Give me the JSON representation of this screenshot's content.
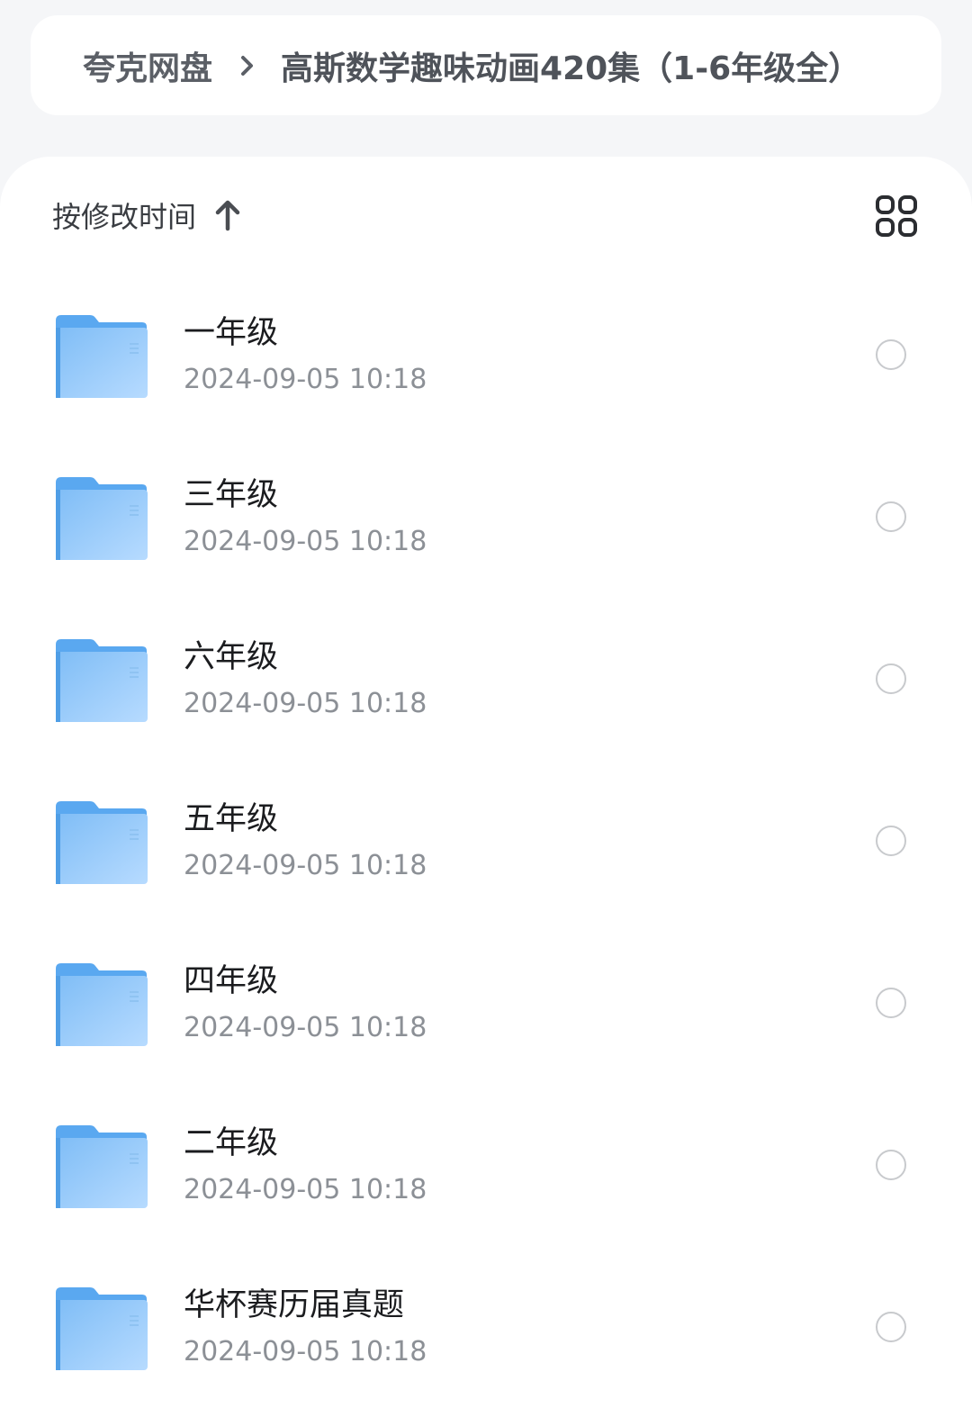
{
  "breadcrumb": {
    "root": "夸克网盘",
    "current": "高斯数学趣味动画420集（1-6年级全）"
  },
  "sort": {
    "label": "按修改时间",
    "direction_icon": "arrow-up-icon"
  },
  "view_toggle_icon": "grid-view-icon",
  "colors": {
    "folder_light": "#b7dbff",
    "folder_dark": "#5aa8f0",
    "background": "#f5f6f8"
  },
  "files": [
    {
      "name": "一年级",
      "time": "2024-09-05 10:18"
    },
    {
      "name": "三年级",
      "time": "2024-09-05 10:18"
    },
    {
      "name": "六年级",
      "time": "2024-09-05 10:18"
    },
    {
      "name": "五年级",
      "time": "2024-09-05 10:18"
    },
    {
      "name": "四年级",
      "time": "2024-09-05 10:18"
    },
    {
      "name": "二年级",
      "time": "2024-09-05 10:18"
    },
    {
      "name": "华杯赛历届真题",
      "time": "2024-09-05 10:18"
    }
  ]
}
